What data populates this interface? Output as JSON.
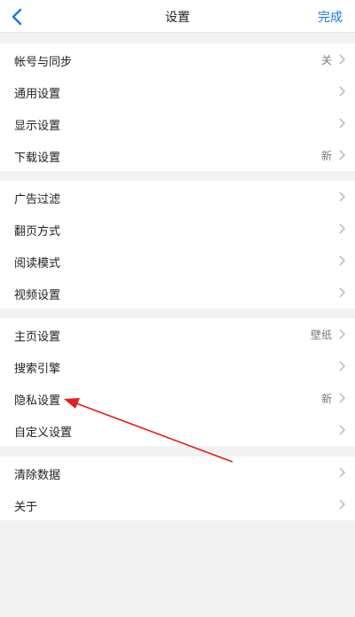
{
  "header": {
    "title": "设置",
    "done_label": "完成",
    "back_icon": "chevron-left-icon",
    "accent_color": "#1a73e8"
  },
  "groups": [
    {
      "items": [
        {
          "label": "帐号与同步",
          "value": "关"
        },
        {
          "label": "通用设置",
          "value": ""
        },
        {
          "label": "显示设置",
          "value": ""
        },
        {
          "label": "下载设置",
          "value": "新"
        }
      ]
    },
    {
      "items": [
        {
          "label": "广告过滤",
          "value": ""
        },
        {
          "label": "翻页方式",
          "value": ""
        },
        {
          "label": "阅读模式",
          "value": ""
        },
        {
          "label": "视频设置",
          "value": ""
        }
      ]
    },
    {
      "items": [
        {
          "label": "主页设置",
          "value": "壁纸"
        },
        {
          "label": "搜索引擎",
          "value": ""
        },
        {
          "label": "隐私设置",
          "value": "新"
        },
        {
          "label": "自定义设置",
          "value": ""
        }
      ]
    },
    {
      "items": [
        {
          "label": "清除数据",
          "value": ""
        },
        {
          "label": "关于",
          "value": ""
        }
      ]
    }
  ],
  "annotation": {
    "arrow_color": "#e0201c"
  }
}
